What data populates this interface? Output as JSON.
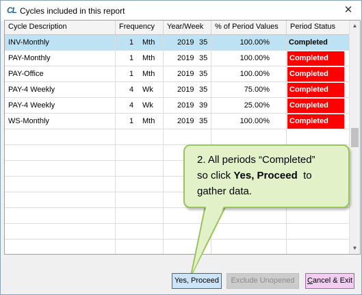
{
  "window": {
    "icon_text": "CL",
    "title": "Cycles included in this report",
    "close_glyph": "✕"
  },
  "table": {
    "headers": [
      "Cycle Description",
      "Frequency",
      "Year/Week",
      "% of Period Values",
      "Period Status"
    ],
    "rows": [
      {
        "desc": "INV-Monthly",
        "freq_n": "1",
        "freq_u": "Mth",
        "year": "2019",
        "week": "35",
        "pct": "100.00%",
        "status": "Completed",
        "status_style": "plain",
        "selected": true
      },
      {
        "desc": "PAY-Monthly",
        "freq_n": "1",
        "freq_u": "Mth",
        "year": "2019",
        "week": "35",
        "pct": "100.00%",
        "status": "Completed",
        "status_style": "red",
        "selected": false
      },
      {
        "desc": "PAY-Office",
        "freq_n": "1",
        "freq_u": "Mth",
        "year": "2019",
        "week": "35",
        "pct": "100.00%",
        "status": "Completed",
        "status_style": "red",
        "selected": false
      },
      {
        "desc": "PAY-4 Weekly",
        "freq_n": "4",
        "freq_u": "Wk",
        "year": "2019",
        "week": "35",
        "pct": "75.00%",
        "status": "Completed",
        "status_style": "red",
        "selected": false
      },
      {
        "desc": "PAY-4 Weekly",
        "freq_n": "4",
        "freq_u": "Wk",
        "year": "2019",
        "week": "39",
        "pct": "25.00%",
        "status": "Completed",
        "status_style": "red",
        "selected": false
      },
      {
        "desc": "WS-Monthly",
        "freq_n": "1",
        "freq_u": "Mth",
        "year": "2019",
        "week": "35",
        "pct": "100.00%",
        "status": "Completed",
        "status_style": "red",
        "selected": false
      }
    ],
    "status_color": "#ff0000",
    "selected_row_color": "#bde2f4"
  },
  "callout": {
    "line1": "2. All periods “Completed”",
    "line2_pre": "so click ",
    "line2_bold": "Yes, Proceed",
    "line2_post": "  to",
    "line3": "gather data."
  },
  "buttons": {
    "proceed": "Yes, Proceed",
    "exclude": "Exclude Unopened",
    "cancel_mnemonic": "C",
    "cancel_rest": "ancel & Exit"
  },
  "scrollbar": {
    "up_icon": "arrow-up",
    "down_icon": "arrow-down"
  }
}
